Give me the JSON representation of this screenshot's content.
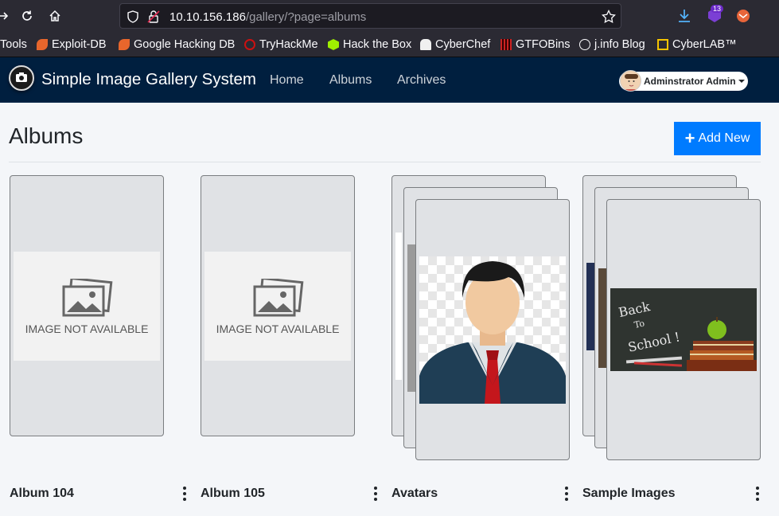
{
  "browser": {
    "url_host": "10.10.156.186",
    "url_path": "/gallery/?page=albums",
    "badge_count": "13",
    "bookmarks": [
      {
        "label": "Tools"
      },
      {
        "label": "Exploit-DB"
      },
      {
        "label": "Google Hacking DB"
      },
      {
        "label": "TryHackMe"
      },
      {
        "label": "Hack the Box"
      },
      {
        "label": "CyberChef"
      },
      {
        "label": "GTFOBins"
      },
      {
        "label": "j.info Blog"
      },
      {
        "label": "CyberLAB™"
      }
    ]
  },
  "navbar": {
    "brand": "Simple Image Gallery System",
    "links": [
      {
        "label": "Home"
      },
      {
        "label": "Albums"
      },
      {
        "label": "Archives"
      }
    ],
    "user_name": "Adminstrator Admin"
  },
  "main": {
    "title": "Albums",
    "add_button_label": "Add New",
    "image_not_available": "IMAGE NOT AVAILABLE",
    "albums": [
      {
        "name": "Album 104"
      },
      {
        "name": "Album 105"
      },
      {
        "name": "Avatars"
      },
      {
        "name": "Sample Images"
      }
    ]
  },
  "colors": {
    "navbar_bg": "#001f3f",
    "accent": "#007bff",
    "browser_chrome": "#2b2a33"
  }
}
